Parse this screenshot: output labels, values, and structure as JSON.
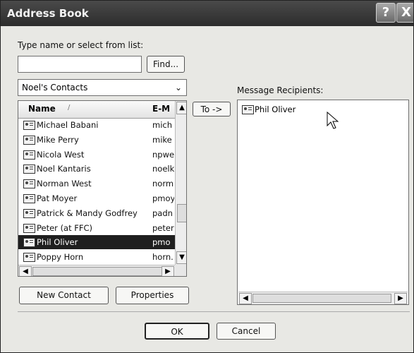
{
  "window": {
    "title": "Address Book",
    "help_label": "?",
    "close_label": "X"
  },
  "search": {
    "label": "Type name or select from list:",
    "value": "",
    "placeholder": "",
    "find_label": "Find..."
  },
  "source": {
    "selected": "Noel's Contacts",
    "arrow": "⌄"
  },
  "contacts": {
    "columns": {
      "name": "Name",
      "email": "E-M"
    },
    "rows": [
      {
        "name": "Michael Babani",
        "email": "mich"
      },
      {
        "name": "Mike Perry",
        "email": "mike"
      },
      {
        "name": "Nicola West",
        "email": "npwe"
      },
      {
        "name": "Noel Kantaris",
        "email": "noelk"
      },
      {
        "name": "Norman West",
        "email": "norm"
      },
      {
        "name": "Pat Moyer",
        "email": "pmoy"
      },
      {
        "name": "Patrick & Mandy Godfrey",
        "email": "padn"
      },
      {
        "name": "Peter (at FFC)",
        "email": "peter"
      },
      {
        "name": "Phil Oliver",
        "email": "pmo"
      },
      {
        "name": "Poppy Horn",
        "email": "horn."
      }
    ],
    "selected_index": 8
  },
  "actions": {
    "to_label": "To ->",
    "new_contact_label": "New Contact",
    "properties_label": "Properties",
    "ok_label": "OK",
    "cancel_label": "Cancel"
  },
  "recipients": {
    "label": "Message Recipients:",
    "items": [
      {
        "name": "Phil Oliver"
      }
    ]
  },
  "scrollbars": {
    "up": "▲",
    "down": "▼",
    "left": "◀",
    "right": "▶"
  },
  "colors": {
    "titlebar": "#2c2c2c",
    "selected_row": "#1f1f1f",
    "window_bg": "#e8e8e4"
  },
  "icons": {
    "contact": "contact-card-icon",
    "cursor": "mouse-pointer-icon"
  }
}
